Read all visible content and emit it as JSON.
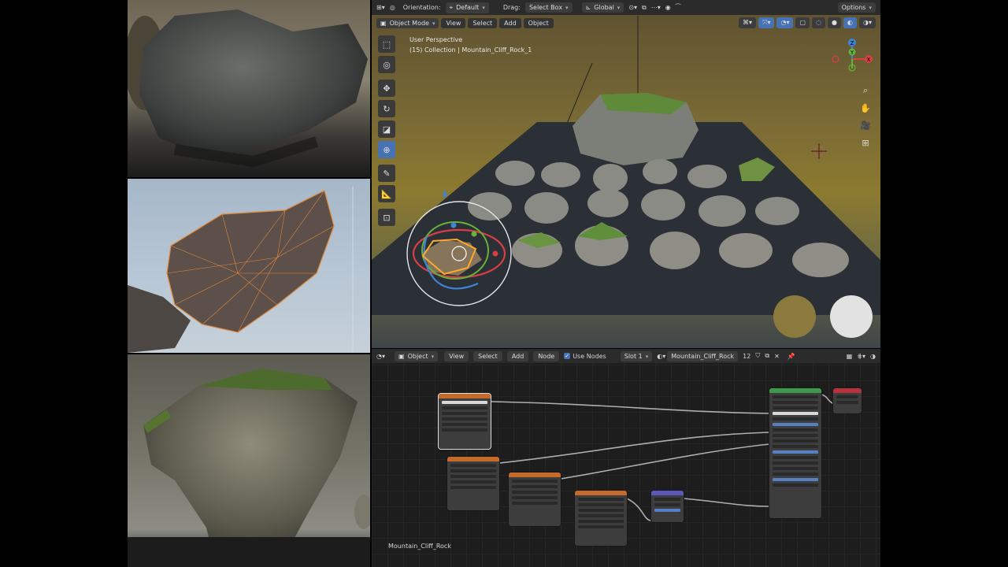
{
  "viewport": {
    "header": {
      "orientation_label": "Orientation:",
      "orientation_value": "Default",
      "drag_label": "Drag:",
      "drag_value": "Select Box",
      "transform_space": "Global",
      "options": "Options"
    },
    "menu": {
      "mode": "Object Mode",
      "view": "View",
      "select": "Select",
      "add": "Add",
      "object": "Object"
    },
    "info": {
      "perspective": "User Perspective",
      "collection": "(15) Collection | Mountain_Cliff_Rock_1"
    },
    "gizmo_axes": [
      "Z",
      "Y",
      "X"
    ]
  },
  "node_editor": {
    "header": {
      "type": "Object",
      "view": "View",
      "select": "Select",
      "add": "Add",
      "node": "Node",
      "use_nodes": "Use Nodes",
      "slot": "Slot 1",
      "material": "Mountain_Cliff_Rock",
      "users": "12"
    },
    "material_label": "Mountain_Cliff_Rock"
  },
  "colors": {
    "accent": "#4772b3",
    "texture_node": "#c56a2b",
    "shader_node": "#3d9a4a",
    "output_node": "#b8323b",
    "converter_node": "#5a58b8"
  }
}
